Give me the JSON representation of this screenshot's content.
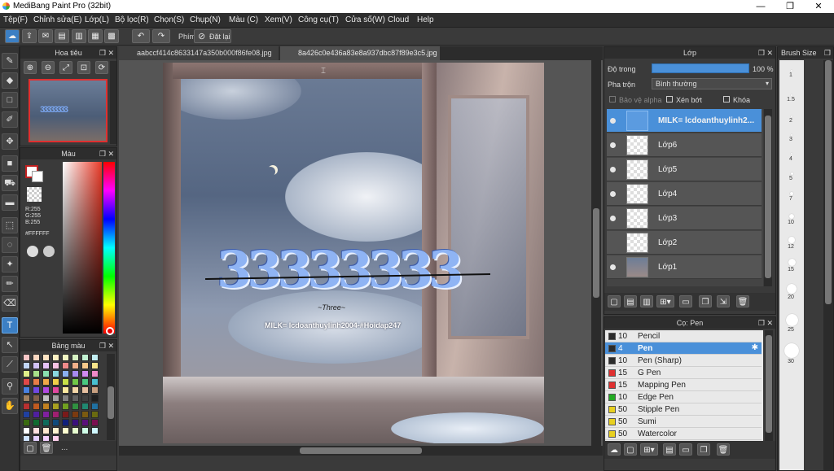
{
  "window": {
    "title": "MediBang Paint Pro (32bit)",
    "minimize": "—",
    "restore": "❐",
    "close": "✕"
  },
  "menu": [
    "Tệp(F)",
    "Chỉnh sửa(E)",
    "Lớp(L)",
    "Bộ lọc(R)",
    "Chọn(S)",
    "Chụp(N)",
    "Màu (C)",
    "Xem(V)",
    "Công cụ(T)",
    "Cửa số(W)",
    "Cloud",
    "Help"
  ],
  "toolbar": {
    "keys_label": "Phím",
    "reset_label": "Đặt lại"
  },
  "tabs": [
    "aabccf414c8633147a350b000f86fe08.jpg",
    "8a426c0e436a83e8a937dbc87f89e3c5.jpg"
  ],
  "navigator": {
    "title": "Hoa tiêu"
  },
  "color_panel": {
    "title": "Màu",
    "r": "R:255",
    "g": "G:255",
    "b": "B:255",
    "hex": "#FFFFFF"
  },
  "palette": {
    "title": "Bảng màu",
    "dots": "...",
    "colors": [
      "#f7c6c6",
      "#f9d7c0",
      "#fde3c2",
      "#fdf0c2",
      "#f2f7c2",
      "#d6f2c2",
      "#c2f2d2",
      "#c2eef2",
      "#c2d6f7",
      "#d2c2f7",
      "#e6c2f7",
      "#f7c2e3",
      "#f08a8a",
      "#f4b08a",
      "#f9c98a",
      "#f9e58a",
      "#e0f08a",
      "#a8e08a",
      "#8ae0b0",
      "#8ad8e0",
      "#8ab0f0",
      "#a88af0",
      "#d08af0",
      "#f08ac8",
      "#e04848",
      "#e87d48",
      "#f0a848",
      "#f0d048",
      "#c8e048",
      "#70c848",
      "#48c880",
      "#48c0d0",
      "#4880e0",
      "#7048e0",
      "#b048e0",
      "#e048a0",
      "#fbe9a0",
      "#f4d7a8",
      "#e6c0a0",
      "#c8a080",
      "#a08060",
      "#80604a",
      "#c0c0c0",
      "#a0a0a0",
      "#808080",
      "#606060",
      "#404040",
      "#202020",
      "#b83030",
      "#c05a20",
      "#c08020",
      "#a8a020",
      "#70a020",
      "#309040",
      "#208870",
      "#2070a0",
      "#2040a0",
      "#5020a0",
      "#8020a0",
      "#a02070",
      "#7a1a1a",
      "#7a3a10",
      "#7a5a10",
      "#6a6a10",
      "#3a6a10",
      "#106a30",
      "#106a5a",
      "#104a7a",
      "#10207a",
      "#3a107a",
      "#5a107a",
      "#7a1050",
      "#ffffff",
      "#ffe0e0",
      "#ffe8d0",
      "#fff4d0",
      "#ffffd0",
      "#e8ffd0",
      "#d0ffe8",
      "#d0f8ff",
      "#d0e4ff",
      "#e4d0ff",
      "#f4d0ff",
      "#ffd0ec"
    ]
  },
  "layers_panel": {
    "title": "Lớp",
    "opacity_label": "Độ trong",
    "opacity_value": "100 %",
    "blend_label": "Pha trộn",
    "blend_value": "Bình thường",
    "protect_alpha": "Bảo vệ alpha",
    "clipping": "Xén bớt",
    "lock": "Khóa",
    "layers": [
      {
        "name": "MILK= lcdoanthuylinh2...",
        "selected": true
      },
      {
        "name": "Lớp6"
      },
      {
        "name": "Lớp5"
      },
      {
        "name": "Lớp4"
      },
      {
        "name": "Lớp3"
      },
      {
        "name": "Lớp2"
      },
      {
        "name": "Lớp1"
      }
    ]
  },
  "brush_panel": {
    "title": "Cọ: Pen",
    "brushes": [
      {
        "size": "10",
        "name": "Pencil",
        "color": "#2b2b2b"
      },
      {
        "size": "4",
        "name": "Pen",
        "color": "#2b2b2b",
        "selected": true
      },
      {
        "size": "10",
        "name": "Pen (Sharp)",
        "color": "#2b2b2b"
      },
      {
        "size": "15",
        "name": "G Pen",
        "color": "#e03030"
      },
      {
        "size": "15",
        "name": "Mapping Pen",
        "color": "#e03030"
      },
      {
        "size": "10",
        "name": "Edge Pen",
        "color": "#22aa22"
      },
      {
        "size": "50",
        "name": "Stipple Pen",
        "color": "#e8d020"
      },
      {
        "size": "50",
        "name": "Sumi",
        "color": "#e8d020"
      },
      {
        "size": "50",
        "name": "Watercolor",
        "color": "#e8d020"
      }
    ]
  },
  "brush_size_panel": {
    "title": "Brush Size",
    "sizes": [
      "1",
      "1.5",
      "2",
      "3",
      "4",
      "5",
      "7",
      "10",
      "12",
      "15",
      "20",
      "25",
      "30"
    ]
  },
  "canvas_art": {
    "threes": "33333333",
    "signature_small": "~Three~",
    "watermark": "MILK= lcdoanthuylinh2004-#Hoidap247"
  }
}
